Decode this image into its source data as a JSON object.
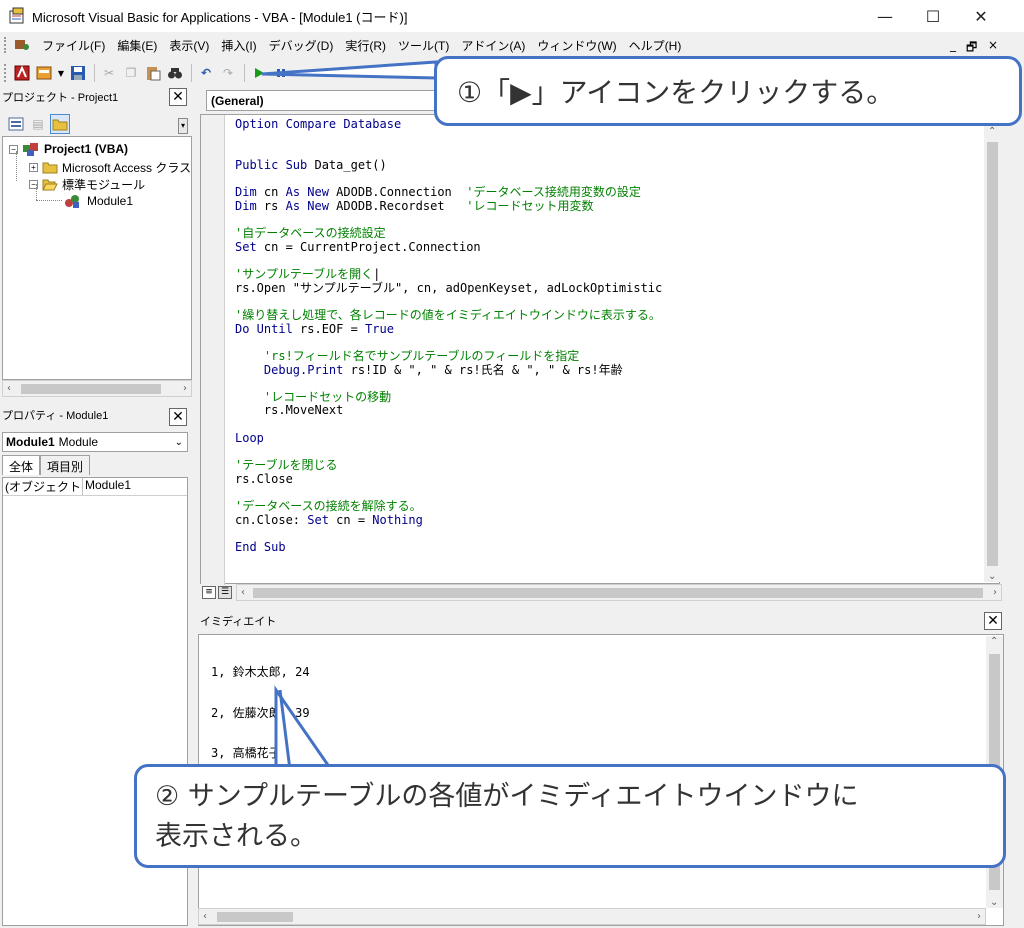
{
  "window": {
    "title": "Microsoft Visual Basic for Applications - VBA - [Module1 (コード)]",
    "minimize": "—",
    "maximize": "☐",
    "close": "✕"
  },
  "menubar": {
    "items": [
      "ファイル(F)",
      "編集(E)",
      "表示(V)",
      "挿入(I)",
      "デバッグ(D)",
      "実行(R)",
      "ツール(T)",
      "アドイン(A)",
      "ウィンドウ(W)",
      "ヘルプ(H)"
    ],
    "mdi_min": "_",
    "mdi_restore": "🗗",
    "mdi_close": "×"
  },
  "project_panel": {
    "title": "プロジェクト - Project1",
    "tree": {
      "root": "Project1 (VBA)",
      "access_class": "Microsoft Access クラス",
      "std_modules": "標準モジュール",
      "module": "Module1"
    }
  },
  "properties_panel": {
    "title": "プロパティ - Module1",
    "combo_bold": "Module1",
    "combo_type": "Module",
    "tab_all": "全体",
    "tab_category": "項目別",
    "row_key": "(オブジェクト名)",
    "row_value": "Module1"
  },
  "code_window": {
    "object_combo": "(General)",
    "lines": [
      [
        [
          "kw",
          "Option Compare Database"
        ]
      ],
      [],
      [],
      [
        [
          "kw",
          "Public Sub "
        ],
        [
          "tx",
          "Data_get()"
        ]
      ],
      [],
      [
        [
          "kw",
          "Dim "
        ],
        [
          "tx",
          "cn "
        ],
        [
          "kw",
          "As New "
        ],
        [
          "tx",
          "ADODB.Connection  "
        ],
        [
          "cm",
          "'データベース接続用変数の設定"
        ]
      ],
      [
        [
          "kw",
          "Dim "
        ],
        [
          "tx",
          "rs "
        ],
        [
          "kw",
          "As New "
        ],
        [
          "tx",
          "ADODB.Recordset   "
        ],
        [
          "cm",
          "'レコードセット用変数"
        ]
      ],
      [],
      [
        [
          "cm",
          "'自データベースの接続設定"
        ]
      ],
      [
        [
          "kw",
          "Set "
        ],
        [
          "tx",
          "cn = CurrentProject.Connection"
        ]
      ],
      [],
      [
        [
          "cm",
          "'サンプルテーブルを開く"
        ],
        [
          "tx",
          "|"
        ]
      ],
      [
        [
          "tx",
          "rs.Open \"サンプルテーブル\", cn, adOpenKeyset, adLockOptimistic"
        ]
      ],
      [],
      [
        [
          "cm",
          "'繰り替えし処理で、各レコードの値をイミディエイトウインドウに表示する。"
        ]
      ],
      [
        [
          "kw",
          "Do Until "
        ],
        [
          "tx",
          "rs.EOF = "
        ],
        [
          "kw",
          "True"
        ]
      ],
      [],
      [
        [
          "tx",
          "    "
        ],
        [
          "cm",
          "'rs!フィールド名でサンプルテーブルのフィールドを指定"
        ]
      ],
      [
        [
          "tx",
          "    "
        ],
        [
          "kw",
          "Debug.Print "
        ],
        [
          "tx",
          "rs!ID & \", \" & rs!氏名 & \", \" & rs!年齢"
        ]
      ],
      [],
      [
        [
          "tx",
          "    "
        ],
        [
          "cm",
          "'レコードセットの移動"
        ]
      ],
      [
        [
          "tx",
          "    rs.MoveNext"
        ]
      ],
      [],
      [
        [
          "kw",
          "Loop"
        ]
      ],
      [],
      [
        [
          "cm",
          "'テーブルを閉じる"
        ]
      ],
      [
        [
          "tx",
          "rs.Close"
        ]
      ],
      [],
      [
        [
          "cm",
          "'データベースの接続を解除する。"
        ]
      ],
      [
        [
          "tx",
          "cn.Close: "
        ],
        [
          "kw",
          "Set "
        ],
        [
          "tx",
          "cn = "
        ],
        [
          "kw",
          "Nothing"
        ]
      ],
      [],
      [
        [
          "kw",
          "End Sub"
        ]
      ]
    ]
  },
  "immediate_window": {
    "title": "イミディエイト",
    "lines": [
      "1, 鈴木太郎, 24",
      "2, 佐藤次郎, 39",
      "3, 高橋花子, 42"
    ]
  },
  "callouts": {
    "run_instruction": "①「▶」アイコンをクリックする。",
    "result_line1": "② サンプルテーブルの各値がイミディエイトウインドウに",
    "result_line2": "表示される。"
  },
  "colors": {
    "keyword": "#00008b",
    "comment": "#008000",
    "callout_border": "#4472c4"
  }
}
